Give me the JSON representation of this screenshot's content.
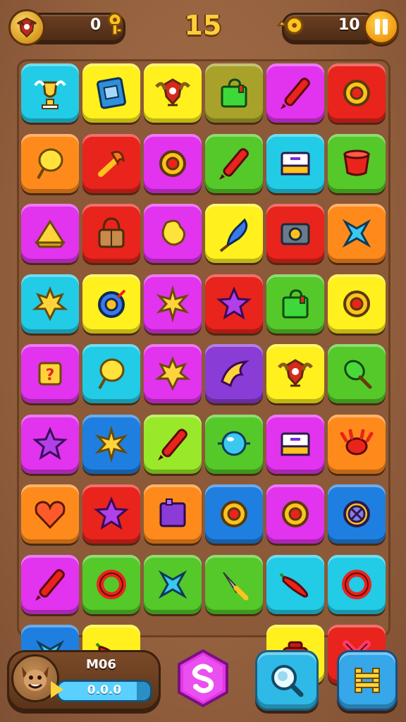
{
  "header": {
    "coins_value": "0",
    "level": "15",
    "moves_value": "10"
  },
  "player": {
    "name": "M06",
    "progress_text": "0.0.0",
    "progress_fraction": 0.85
  },
  "colors": {
    "cyan": "#22cbe6",
    "yellow": "#fff01e",
    "orange": "#ff8a1c",
    "red": "#e8241c",
    "magenta": "#e233ef",
    "green": "#55c82a",
    "lime": "#9ae82a",
    "blue": "#1e7fe0",
    "purple": "#8a3cd6",
    "olive": "#a8a22a"
  },
  "board": {
    "tiles": [
      {
        "color": "cyan",
        "icon": "trophy-icon"
      },
      {
        "color": "yellow",
        "icon": "book-icon"
      },
      {
        "color": "yellow",
        "icon": "crest-icon"
      },
      {
        "color": "olive",
        "icon": "bag-icon"
      },
      {
        "color": "magenta",
        "icon": "marker-icon"
      },
      {
        "color": "red",
        "icon": "ring-icon"
      },
      {
        "color": "orange",
        "icon": "balloon-icon"
      },
      {
        "color": "red",
        "icon": "torch-icon"
      },
      {
        "color": "magenta",
        "icon": "ring-icon"
      },
      {
        "color": "green",
        "icon": "marker-icon"
      },
      {
        "color": "cyan",
        "icon": "card-icon"
      },
      {
        "color": "green",
        "icon": "cup-icon"
      },
      {
        "color": "magenta",
        "icon": "pyramid-icon"
      },
      {
        "color": "red",
        "icon": "basket-icon"
      },
      {
        "color": "magenta",
        "icon": "bean-icon"
      },
      {
        "color": "yellow",
        "icon": "feather-icon"
      },
      {
        "color": "red",
        "icon": "camera-icon"
      },
      {
        "color": "orange",
        "icon": "star4-icon"
      },
      {
        "color": "cyan",
        "icon": "leaf-icon"
      },
      {
        "color": "yellow",
        "icon": "compass-icon"
      },
      {
        "color": "magenta",
        "icon": "sun-icon"
      },
      {
        "color": "red",
        "icon": "star-icon"
      },
      {
        "color": "green",
        "icon": "bag-icon"
      },
      {
        "color": "yellow",
        "icon": "ring-icon"
      },
      {
        "color": "magenta",
        "icon": "question-icon"
      },
      {
        "color": "cyan",
        "icon": "balloon-icon"
      },
      {
        "color": "magenta",
        "icon": "leaf-icon"
      },
      {
        "color": "purple",
        "icon": "claw-icon"
      },
      {
        "color": "yellow",
        "icon": "crest-icon"
      },
      {
        "color": "green",
        "icon": "spoon-icon"
      },
      {
        "color": "magenta",
        "icon": "star-icon"
      },
      {
        "color": "blue",
        "icon": "sun-icon"
      },
      {
        "color": "lime",
        "icon": "marker-icon"
      },
      {
        "color": "green",
        "icon": "orb-icon"
      },
      {
        "color": "magenta",
        "icon": "card-icon"
      },
      {
        "color": "orange",
        "icon": "crab-icon"
      },
      {
        "color": "orange",
        "icon": "heart-icon"
      },
      {
        "color": "red",
        "icon": "star-icon"
      },
      {
        "color": "orange",
        "icon": "box-icon"
      },
      {
        "color": "blue",
        "icon": "ring-icon"
      },
      {
        "color": "magenta",
        "icon": "ring-icon"
      },
      {
        "color": "blue",
        "icon": "cross-ring-icon"
      },
      {
        "color": "magenta",
        "icon": "marker-icon"
      },
      {
        "color": "green",
        "icon": "donut-icon"
      },
      {
        "color": "green",
        "icon": "star4-icon"
      },
      {
        "color": "green",
        "icon": "dagger-icon"
      },
      {
        "color": "cyan",
        "icon": "chili-icon"
      },
      {
        "color": "cyan",
        "icon": "donut-icon"
      },
      {
        "color": "blue",
        "icon": "star4-icon"
      },
      {
        "color": "yellow",
        "icon": "chili-icon"
      },
      null,
      null,
      {
        "color": "yellow",
        "icon": "pot-icon"
      },
      {
        "color": "red",
        "icon": "x-icon"
      }
    ]
  }
}
